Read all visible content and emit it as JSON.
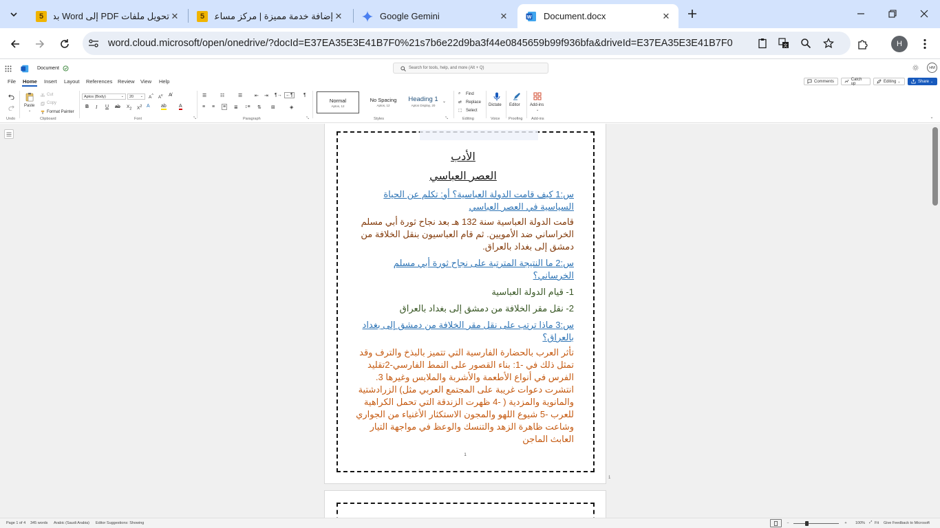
{
  "browser": {
    "tabs": [
      {
        "title": "تحويل ملفات PDF إلى Word بدون",
        "icon": "5",
        "active": false
      },
      {
        "title": "إضافة خدمة مميزة | مركز مساعدة",
        "icon": "5",
        "active": false
      },
      {
        "title": "Google Gemini",
        "icon": "gemini-icon",
        "active": false
      },
      {
        "title": "Document.docx",
        "icon": "word-icon",
        "active": true
      }
    ],
    "url": "word.cloud.microsoft/open/onedrive/?docId=E37EA35E3E41B7F0%21s7b6e22d9ba3f44e0845659b99f936bfa&driveId=E37EA35E3E41B7F0",
    "profile_initial": "H"
  },
  "word": {
    "doc_name": "Document",
    "search_placeholder": "Search for tools, help, and more (Alt + Q)",
    "user_initials": "HM",
    "ribbon_tabs": [
      "File",
      "Home",
      "Insert",
      "Layout",
      "References",
      "Review",
      "View",
      "Help"
    ],
    "comments": "Comments",
    "catchup": "Catch up",
    "editing": "Editing",
    "share": "Share",
    "clipboard": {
      "paste": "Paste",
      "cut": "Cut",
      "copy": "Copy",
      "format_painter": "Format Painter"
    },
    "font_name": "Aptos (Body)",
    "font_size": "20",
    "styles": [
      {
        "name": "Normal",
        "sub": "Aptos, 12"
      },
      {
        "name": "No Spacing",
        "sub": "Aptos, 12"
      },
      {
        "name": "Heading 1",
        "sub": "Aptos Display, 20"
      }
    ],
    "editing_items": {
      "find": "Find",
      "replace": "Replace",
      "select": "Select"
    },
    "dictate": "Dictate",
    "editor": "Editor",
    "addins": "Add-ins",
    "groups": {
      "undo": "Undo",
      "clipboard": "Clipboard",
      "font": "Font",
      "paragraph": "Paragraph",
      "styles": "Styles",
      "editing": "Editing",
      "voice": "Voice",
      "proofing": "Proofing",
      "addins": "Add-ins"
    }
  },
  "document": {
    "title": "الأدب",
    "subtitle": "العصر العباسي",
    "q1": "س:1 كيف قامت الدولة العباسية؟ أو: تكلم عن الحياة السياسية في العصر العباسي",
    "a1": "قامت الدولة العباسية سنة 132 هـ بعد نجاح ثورة أبي مسلم الخراساني ضد الأمويين. ثم قام العباسيون بنقل الخلافة من دمشق إلى بغداد بالعراق.",
    "q2": "س:2 ما النتيجة المترتبة على نجاح ثورة أبي مسلم الخرساني؟",
    "n1": "1- قيام الدولة العباسية",
    "n2": "2- نقل مقر الخلافة من دمشق إلى بغداد بالعراق",
    "q3": "س:3 ماذا ترتب على نقل مقر الخلافة من دمشق إلى بغداد بالعراق؟",
    "a3": "تأثر العرب بالحضارة الفارسية التي تتميز بالبذخ والترف وقد تمثل ذلك في -1: بناء القصور على النمط الفارسي-2تقليد الفرس في أنواع الأطعمة والأشربة والملابس وغيرها 3. انتشرت دعوات غريبة على المجتمع العربي مثل) الزرادشتية والمانوية والمزدية ( -4 ظهرت الزندقة التي تحمل الكراهية للعرب -5 شيوع اللهو والمجون الاستكثار الأغنياء من الجواري وشاعت ظاهرة الزهد والتنسك والوعظ في مواجهة التيار العابث الماجن",
    "page_number": "1",
    "margin_number": "1"
  },
  "status": {
    "page": "Page 1 of 4",
    "words": "345 words",
    "language": "Arabic (Saudi Arabia)",
    "suggestions": "Editor Suggestions: Showing",
    "zoom": "100%",
    "fit": "Fit",
    "feedback": "Give Feedback to Microsoft"
  }
}
